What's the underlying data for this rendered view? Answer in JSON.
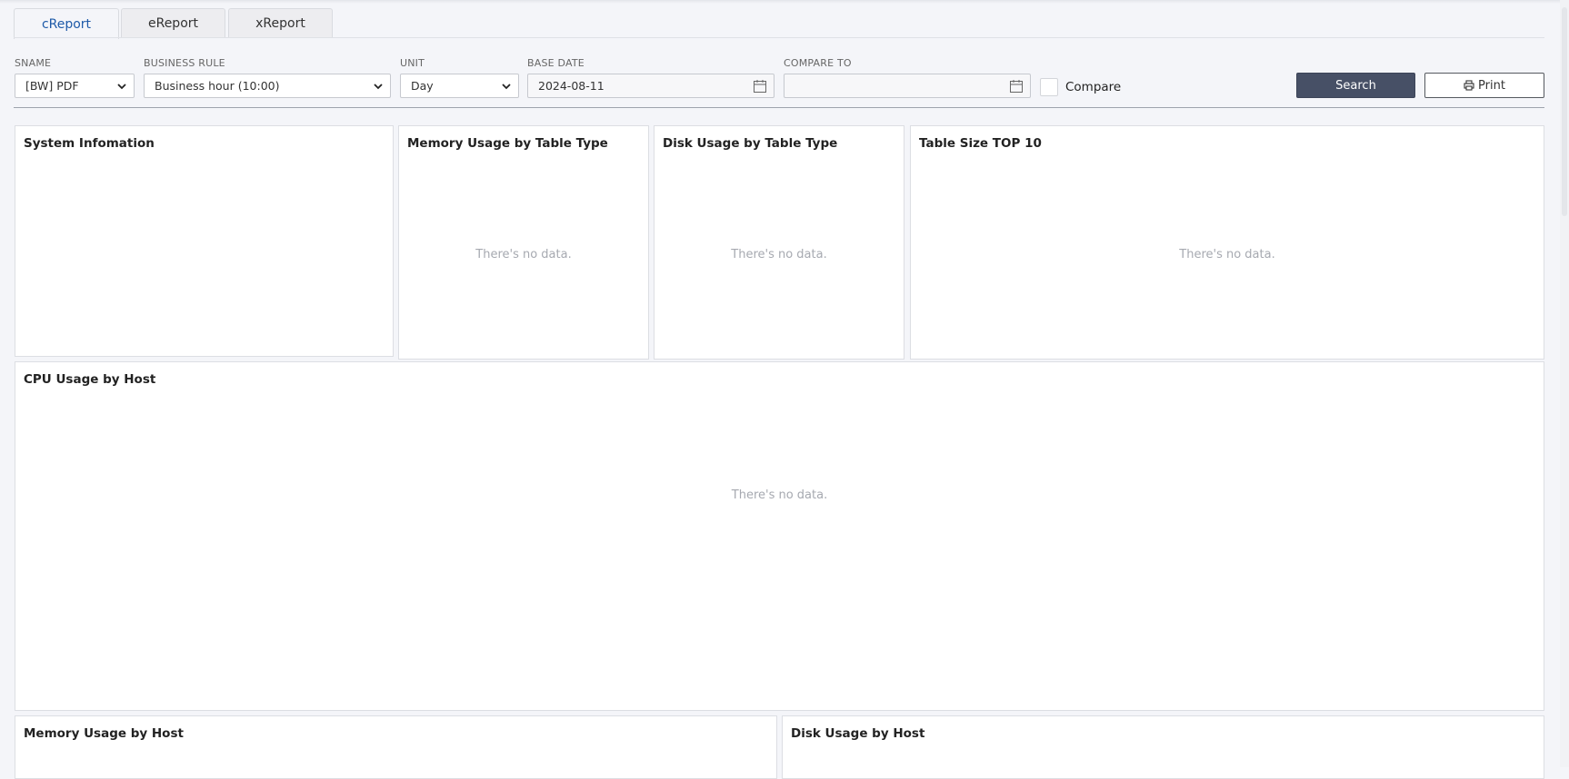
{
  "tabs": [
    {
      "label": "cReport",
      "active": true
    },
    {
      "label": "eReport",
      "active": false
    },
    {
      "label": "xReport",
      "active": false
    }
  ],
  "filters": {
    "sname": {
      "label": "SNAME",
      "value": "[BW] PDF"
    },
    "business_rule": {
      "label": "BUSINESS RULE",
      "value": "Business hour (10:00)"
    },
    "unit": {
      "label": "UNIT",
      "value": "Day"
    },
    "base_date": {
      "label": "BASE DATE",
      "value": "2024-08-11"
    },
    "compare_to": {
      "label": "COMPARE TO",
      "value": ""
    },
    "compare": {
      "label": "Compare",
      "checked": false
    }
  },
  "buttons": {
    "search": "Search",
    "print": "Print"
  },
  "panels": {
    "system_info": {
      "title": "System Infomation"
    },
    "memory_by_table_type": {
      "title": "Memory Usage by Table Type",
      "empty": "There's no data."
    },
    "disk_by_table_type": {
      "title": "Disk Usage by Table Type",
      "empty": "There's no data."
    },
    "table_size_top10": {
      "title": "Table Size TOP 10",
      "empty": "There's no data."
    },
    "cpu_by_host": {
      "title": "CPU Usage by Host",
      "empty": "There's no data."
    },
    "memory_by_host": {
      "title": "Memory Usage by Host"
    },
    "disk_by_host": {
      "title": "Disk Usage by Host"
    }
  },
  "colors": {
    "active_tab": "#1e5aa8",
    "search_button": "#475066",
    "empty_text": "#a6a9b0"
  }
}
